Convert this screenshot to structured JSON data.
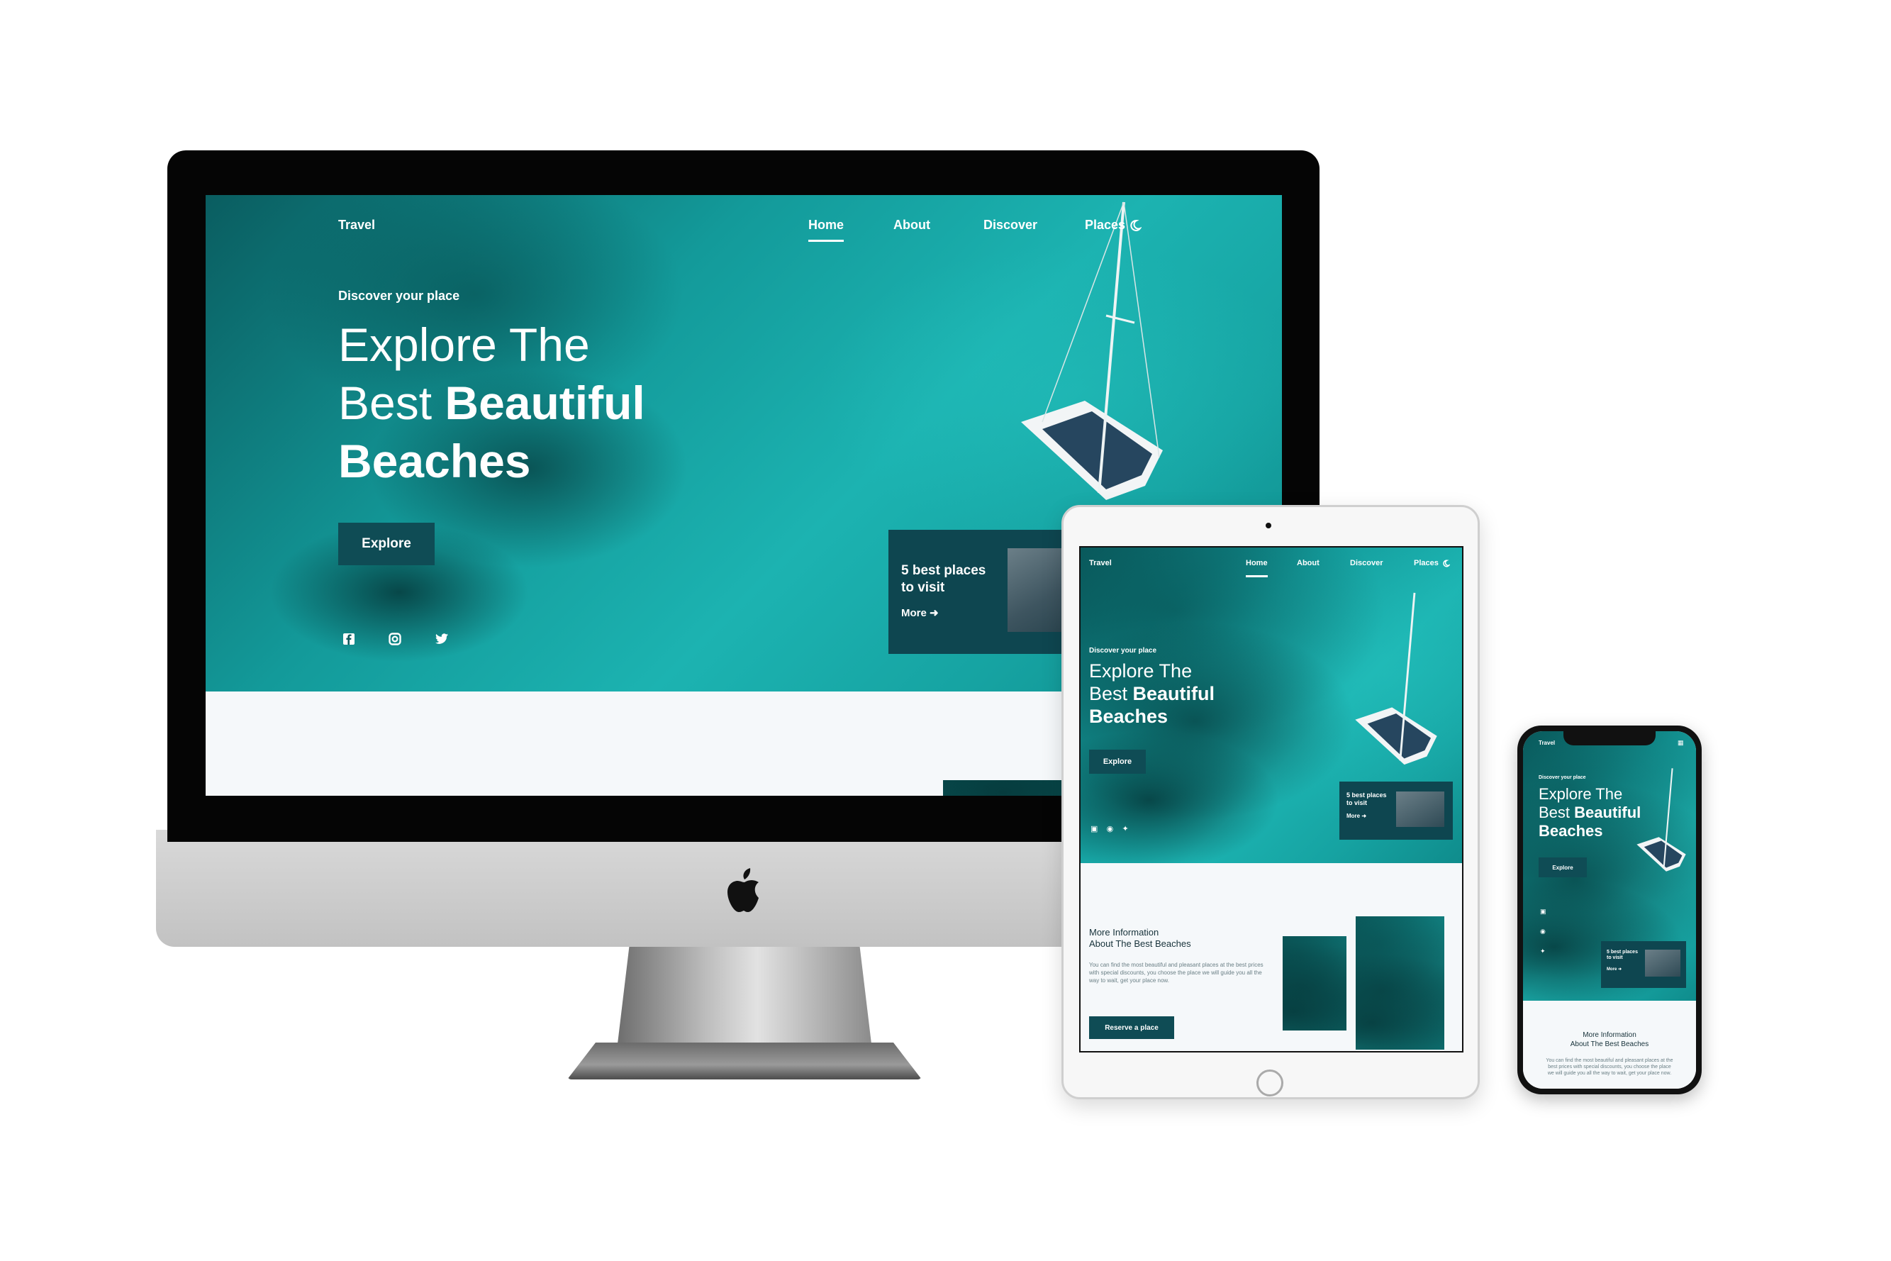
{
  "site": {
    "brand": "Travel",
    "nav": [
      "Home",
      "About",
      "Discover",
      "Places"
    ],
    "kicker": "Discover your place",
    "hero_line1": "Explore The",
    "hero_line2_light": "Best ",
    "hero_line2_bold": "Beautiful",
    "hero_line3": "Beaches",
    "explore_label": "Explore",
    "card_title_1": "5 best places",
    "card_title_2": "to visit",
    "card_more": "More",
    "info_title_1": "More Information",
    "info_title_2": "About The Best Beaches",
    "info_body": "You can find the most beautiful and pleasant places at the best prices with special discounts, you choose the place we will guide you all the way to wait, get your place now.",
    "reserve_label": "Reserve a place"
  },
  "icons": {
    "theme": "moon-icon",
    "social": [
      "facebook-icon",
      "instagram-icon",
      "twitter-icon"
    ],
    "arrow": "arrow-right-icon",
    "brand_logo": "apple-logo"
  },
  "colors": {
    "sea": "#16a3a2",
    "dark_teal": "#0f4c55",
    "device_gray": "#c2c2c2",
    "page_bg": "#f5f8fa"
  }
}
